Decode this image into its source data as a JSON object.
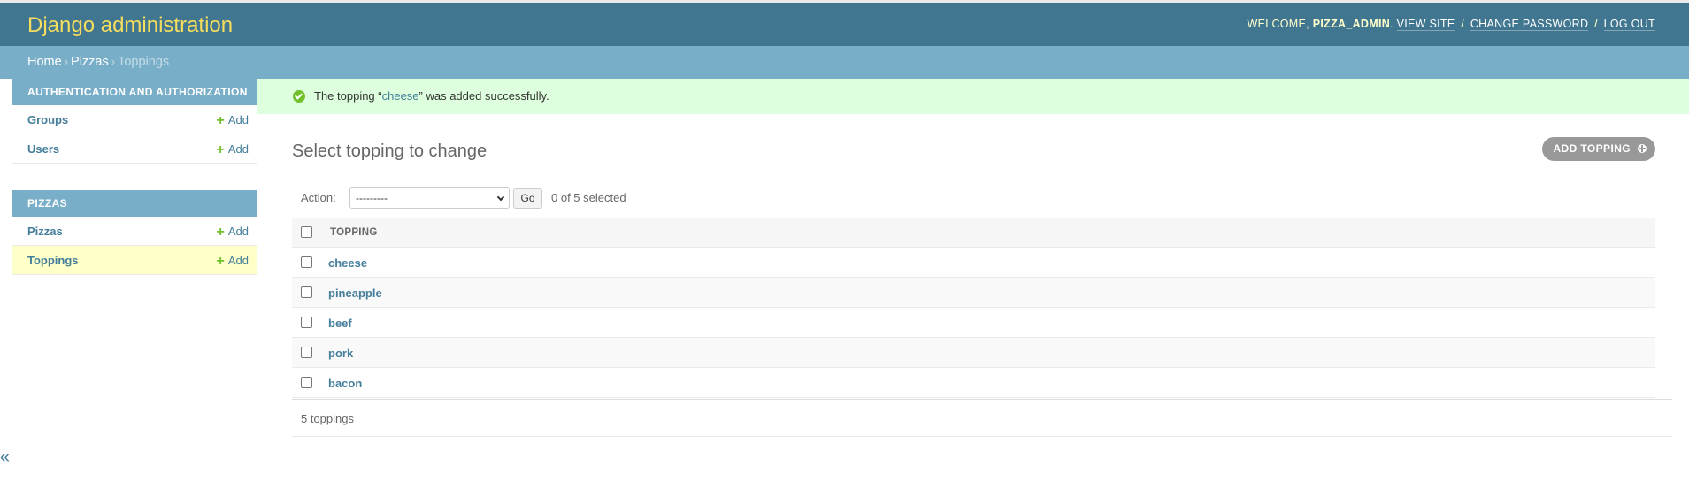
{
  "header": {
    "brand": "Django administration",
    "welcome": "Welcome,",
    "username": "pizza_admin",
    "view_site": "View site",
    "change_password": "Change password",
    "log_out": "Log out",
    "sep": "/"
  },
  "breadcrumbs": {
    "home": "Home",
    "pizzas": "Pizzas",
    "current": "Toppings",
    "arrow": "›"
  },
  "sidebar": {
    "toggle": "«",
    "add_label": "Add",
    "modules": [
      {
        "caption": "Authentication and Authorization",
        "items": [
          "Groups",
          "Users"
        ]
      },
      {
        "caption": "Pizzas",
        "items": [
          "Pizzas",
          "Toppings"
        ]
      }
    ]
  },
  "message": {
    "prefix": "The topping “",
    "link": "cheese",
    "suffix": "” was added successfully."
  },
  "content": {
    "title": "Select topping to change",
    "add_button": "Add topping"
  },
  "actions": {
    "label": "Action:",
    "selected": "---------",
    "go": "Go",
    "counter": "0 of 5 selected"
  },
  "table": {
    "header": "Topping",
    "rows": [
      "cheese",
      "pineapple",
      "beef",
      "pork",
      "bacon"
    ]
  },
  "paginator": {
    "count": "5 toppings"
  },
  "colors": {
    "header_bg": "#417690",
    "brand": "#f5dd5d",
    "breadcrumbs_bg": "#79aec8",
    "link": "#447e9b",
    "success_bg": "#ddffdd",
    "success_icon": "#70bf2b",
    "current_row": "#ffffc8"
  }
}
